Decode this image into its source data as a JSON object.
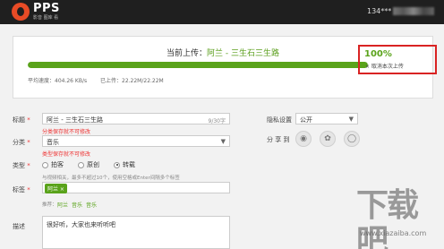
{
  "header": {
    "logo_text": "PPS",
    "logo_sub": "影音 图库 看",
    "user_text": "134***"
  },
  "upload": {
    "title_prefix": "当前上传：",
    "title_name": "阿兰 - 三生石三生路",
    "progress": 1.0,
    "avg_speed": "平均速度：404.26 KB/s",
    "uploaded": "已上传：22.22M/22.22M",
    "percent": "100%",
    "cancel": "× 取消本次上传"
  },
  "form": {
    "title_label": "标题",
    "title_value": "阿兰 - 三生石三生路",
    "title_count": "9/30字",
    "title_error": "分类保存就不可修改",
    "category_label": "分类",
    "category_value": "音乐",
    "category_error": "类型保存就不可修改",
    "type_label": "类型",
    "type_options": [
      "拍客",
      "原创",
      "转载"
    ],
    "type_selected": "转载",
    "type_hint": "与视频相关，最多不超过10个，使用空格或Enter间隔多个标签",
    "tags_label": "标签",
    "tag": "阿兰 ×",
    "recommend_label": "推荐：",
    "recommend_items": [
      "阿兰",
      "音乐",
      "音乐"
    ],
    "desc_label": "描述",
    "desc_value": "很好听，大家也来听听吧",
    "privacy_label": "隐私设置",
    "privacy_value": "公开",
    "share_label": "分 享 到",
    "required_mark": "*",
    "dropdown_icon": "chevron-down-icon"
  },
  "watermark": {
    "text": "下载吧",
    "url": "www.xiazaiba.com"
  }
}
